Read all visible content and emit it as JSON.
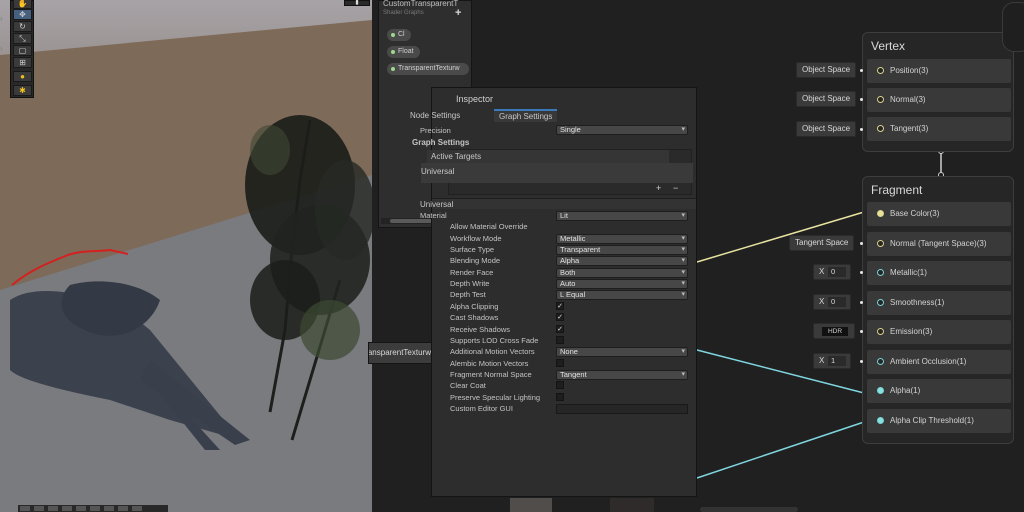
{
  "scene": {
    "toolbar_icons": [
      "hand-icon",
      "move-icon",
      "rotate-icon",
      "scale-icon",
      "rect-icon",
      "transform-icon",
      "light-bulb-icon",
      "light-settings-icon"
    ]
  },
  "blackboard": {
    "title": "CustomTransparentT",
    "subtitle": "Shader Graphs",
    "add_label": "+",
    "properties": [
      "Cl",
      "Float",
      "TransparentTexturw"
    ]
  },
  "property_node": {
    "label": "TransparentTexturw"
  },
  "inspector": {
    "title": "Inspector",
    "tabs": [
      "Node Settings",
      "Graph Settings"
    ],
    "precision_label": "Precision",
    "precision_value": "Single",
    "active_targets_header": "Graph Settings",
    "targets_label": "Active Targets",
    "targets_item": "Universal",
    "targets_add": "+",
    "targets_remove": "−",
    "section": "Universal",
    "rows": [
      {
        "label": "Material",
        "type": "dropdown",
        "value": "Lit"
      },
      {
        "label": "Allow Material Override",
        "type": "none"
      },
      {
        "label": "Workflow Mode",
        "type": "dropdown",
        "value": "Metallic"
      },
      {
        "label": "Surface Type",
        "type": "dropdown",
        "value": "Transparent"
      },
      {
        "label": "Blending Mode",
        "type": "dropdown",
        "value": "Alpha"
      },
      {
        "label": "Render Face",
        "type": "dropdown",
        "value": "Both"
      },
      {
        "label": "Depth Write",
        "type": "dropdown",
        "value": "Auto"
      },
      {
        "label": "Depth Test",
        "type": "dropdown",
        "value": "L Equal"
      },
      {
        "label": "Alpha Clipping",
        "type": "checkbox",
        "checked": true
      },
      {
        "label": "Cast Shadows",
        "type": "checkbox",
        "checked": true
      },
      {
        "label": "Receive Shadows",
        "type": "checkbox",
        "checked": true
      },
      {
        "label": "Supports LOD Cross Fade",
        "type": "checkbox",
        "checked": false
      },
      {
        "label": "Additional Motion Vectors",
        "type": "dropdown",
        "value": "None"
      },
      {
        "label": "Alembic Motion Vectors",
        "type": "checkbox",
        "checked": false
      },
      {
        "label": "Fragment Normal Space",
        "type": "dropdown",
        "value": "Tangent"
      },
      {
        "label": "Clear Coat",
        "type": "checkbox",
        "checked": false
      },
      {
        "label": "Preserve Specular Lighting",
        "type": "checkbox",
        "checked": false
      },
      {
        "label": "Custom Editor GUI",
        "type": "text",
        "value": ""
      }
    ]
  },
  "vertex": {
    "title": "Vertex",
    "blocks": [
      "Position(3)",
      "Normal(3)",
      "Tangent(3)"
    ],
    "inputs": [
      "Object Space",
      "Object Space",
      "Object Space"
    ]
  },
  "fragment": {
    "title": "Fragment",
    "blocks": [
      "Base Color(3)",
      "Normal (Tangent Space)(3)",
      "Metallic(1)",
      "Smoothness(1)",
      "Emission(3)",
      "Ambient Occlusion(1)",
      "Alpha(1)",
      "Alpha Clip Threshold(1)"
    ],
    "tangent_input": "Tangent Space",
    "metallic_x": "X",
    "metallic_value": "0",
    "smoothness_x": "X",
    "smoothness_value": "0",
    "emission_label": "HDR",
    "ao_x": "X",
    "ao_value": "1"
  },
  "colors": {
    "wire_yellow": "#e8e3a0",
    "wire_cyan": "#7fd6e0",
    "accent_blue": "#3a79bb",
    "tree_dark": "#1a1d1a",
    "shadow": "#3a3f4c",
    "red_stroke": "#d42020"
  }
}
